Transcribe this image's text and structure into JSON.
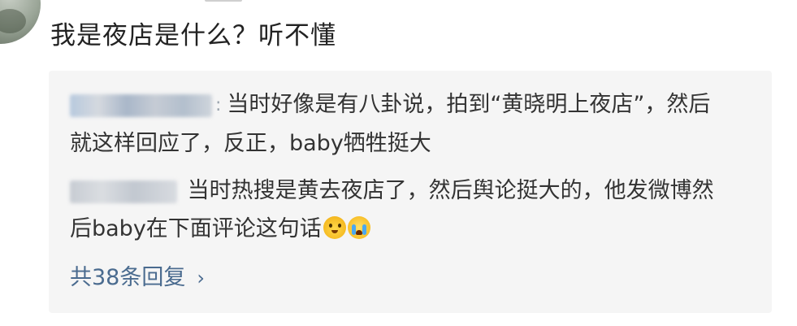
{
  "comment": {
    "text": "我是夜店是什么？听不懂"
  },
  "replies": [
    {
      "name_tail": "‌:",
      "text": "当时好像是有八卦说，拍到“黄晓明上夜店”，然后就这样回应了，反正，baby牺牲挺大"
    },
    {
      "text": "当时热搜是黄去夜店了，然后舆论挺大的，他发微博然后baby在下面评论这句话"
    }
  ],
  "more_replies": {
    "label": "共38条回复",
    "chevron": "›"
  },
  "icons": {
    "emoji_1": "grinning-sweat-emoji-icon",
    "emoji_2": "crying-emoji-icon",
    "chevron": "chevron-right-icon"
  },
  "colors": {
    "reply_background": "#f5f5f5",
    "link": "#4a6b8f"
  }
}
